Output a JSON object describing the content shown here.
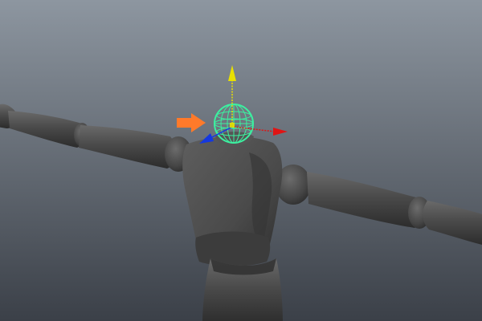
{
  "viewport": {
    "background_top": "#8d96a0",
    "background_bottom": "#3b4048"
  },
  "colors": {
    "mannequin_fill": "#4a4a4a",
    "mannequin_shade": "#2f2f2f",
    "mannequin_highlight": "#646464",
    "selection_wire": "#3cf0a0",
    "axis_x": "#e01414",
    "axis_y": "#e8e000",
    "axis_z": "#1438e0",
    "annotation_arrow": "#ff7a2a"
  },
  "icons": {
    "move_gizmo": "move-manipulator-icon",
    "pointer": "orange-arrow-icon"
  }
}
